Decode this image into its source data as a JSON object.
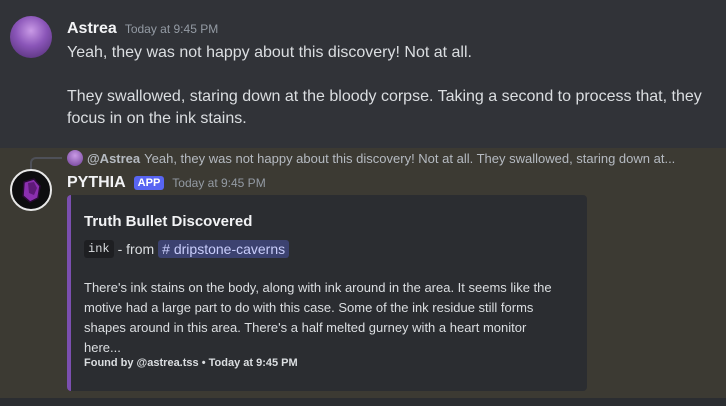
{
  "message1": {
    "username": "Astrea",
    "timestamp": "Today at 9:45 PM",
    "line1": "Yeah, they was not happy about this discovery! Not at all.",
    "line2": "They swallowed, staring down at the bloody corpse. Taking a second to process that, they",
    "line3": "focus in on the ink stains."
  },
  "reply": {
    "username": "@Astrea",
    "text": "Yeah, they was not happy about this discovery! Not at all.  They swallowed, staring down at..."
  },
  "message2": {
    "username": "PYTHIA",
    "badge": "APP",
    "timestamp": "Today at 9:45 PM",
    "embed": {
      "accent_color": "#7b4fb0",
      "title": "Truth Bullet Discovered",
      "code": "ink",
      "from_label": "- from",
      "channel": "# dripstone-caverns",
      "desc_line1": "There's ink stains on the body, along with ink around in the area. It seems like the",
      "desc_line2": "motive had a large part to do with this case. Some of the ink residue still forms",
      "desc_line3": "shapes around in this area. There's a half melted gurney with a heart monitor",
      "desc_line4": "here...",
      "footer": "Found by @astrea.tss • Today at 9:45 PM"
    }
  }
}
